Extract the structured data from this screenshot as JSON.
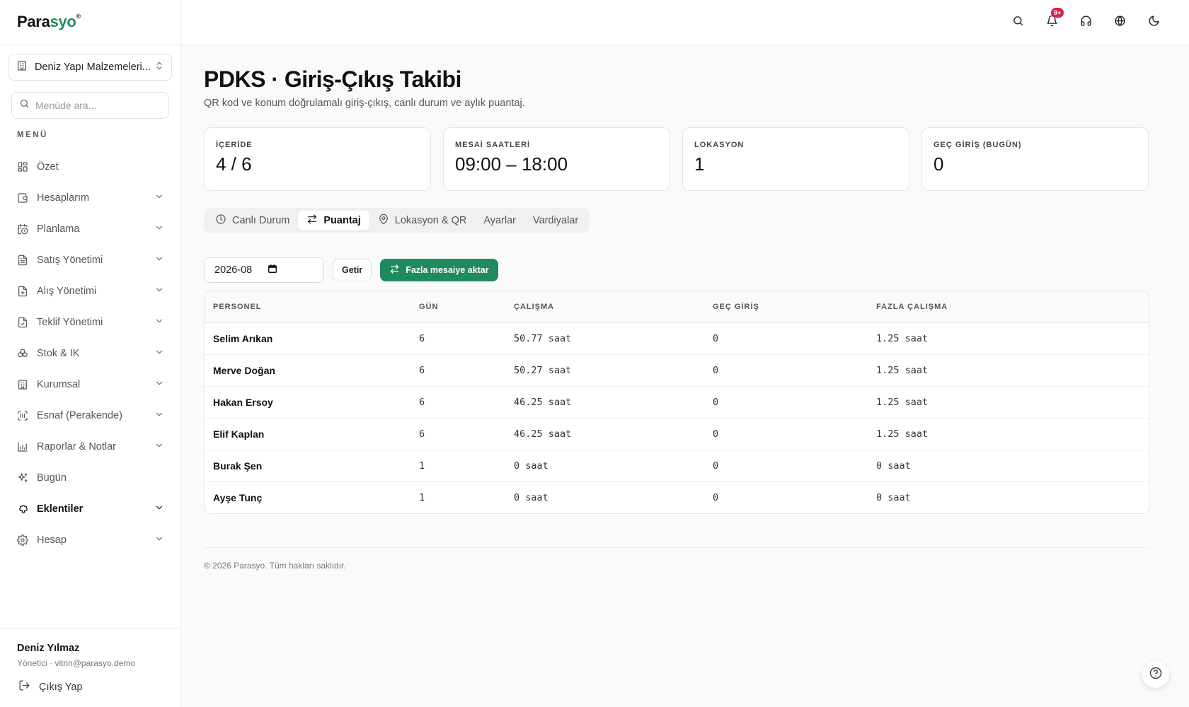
{
  "brand": {
    "part1": "Para",
    "part2": "syo",
    "mark": "®",
    "accent_color": "#1f8a5b"
  },
  "company": {
    "name": "Deniz Yapı Malzemeleri..."
  },
  "search": {
    "placeholder": "Menüde ara..."
  },
  "menu_label": "MENÜ",
  "nav": [
    {
      "label": "Özet",
      "icon": "grid-icon",
      "chevron": false
    },
    {
      "label": "Hesaplarım",
      "icon": "wallet-icon",
      "chevron": true
    },
    {
      "label": "Planlama",
      "icon": "calendar-clock-icon",
      "chevron": true
    },
    {
      "label": "Satış Yönetimi",
      "icon": "receipt-icon",
      "chevron": true
    },
    {
      "label": "Alış Yönetimi",
      "icon": "file-plus-icon",
      "chevron": true
    },
    {
      "label": "Teklif Yönetimi",
      "icon": "file-check-icon",
      "chevron": true
    },
    {
      "label": "Stok & IK",
      "icon": "boxes-icon",
      "chevron": true
    },
    {
      "label": "Kurumsal",
      "icon": "building-icon",
      "chevron": true
    },
    {
      "label": "Esnaf (Perakende)",
      "icon": "scan-icon",
      "chevron": true
    },
    {
      "label": "Raporlar & Notlar",
      "icon": "bar-chart-icon",
      "chevron": true
    },
    {
      "label": "Bugün",
      "icon": "sparkles-icon",
      "chevron": false
    },
    {
      "label": "Eklentiler",
      "icon": "puzzle-icon",
      "chevron": true,
      "active": true
    },
    {
      "label": "Hesap",
      "icon": "gear-icon",
      "chevron": true
    }
  ],
  "user": {
    "name": "Deniz Yılmaz",
    "subtitle": "Yönetici · vitrin@parasyo.demo",
    "logout_label": "Çıkış Yap"
  },
  "topbar": {
    "notification_badge": "9+"
  },
  "page": {
    "title": "PDKS · Giriş-Çıkış Takibi",
    "subtitle": "QR kod ve konum doğrulamalı giriş-çıkış, canlı durum ve aylık puantaj."
  },
  "stats": [
    {
      "label": "İÇERİDE",
      "value": "4 / 6"
    },
    {
      "label": "MESAİ SAATLERİ",
      "value": "09:00 – 18:00"
    },
    {
      "label": "LOKASYON",
      "value": "1"
    },
    {
      "label": "GEÇ GİRİŞ (BUGÜN)",
      "value": "0"
    }
  ],
  "tabs": [
    {
      "label": "Canlı Durum",
      "icon": "clock-icon"
    },
    {
      "label": "Puantaj",
      "icon": "arrows-swap-icon",
      "active": true
    },
    {
      "label": "Lokasyon & QR",
      "icon": "map-pin-icon"
    },
    {
      "label": "Ayarlar",
      "icon": ""
    },
    {
      "label": "Vardiyalar",
      "icon": ""
    }
  ],
  "controls": {
    "month_value": "2026-08",
    "fetch_label": "Getir",
    "transfer_label": "Fazla mesaiye aktar"
  },
  "table": {
    "headers": [
      "PERSONEL",
      "GÜN",
      "ÇALIŞMA",
      "GEÇ GİRİŞ",
      "FAZLA ÇALIŞMA"
    ],
    "rows": [
      [
        "Selim Arıkan",
        "6",
        "50.77 saat",
        "0",
        "1.25 saat"
      ],
      [
        "Merve Doğan",
        "6",
        "50.27 saat",
        "0",
        "1.25 saat"
      ],
      [
        "Hakan Ersoy",
        "6",
        "46.25 saat",
        "0",
        "1.25 saat"
      ],
      [
        "Elif Kaplan",
        "6",
        "46.25 saat",
        "0",
        "1.25 saat"
      ],
      [
        "Burak Şen",
        "1",
        "0 saat",
        "0",
        "0 saat"
      ],
      [
        "Ayşe Tunç",
        "1",
        "0 saat",
        "0",
        "0 saat"
      ]
    ]
  },
  "footer": "© 2026 Parasyo. Tüm hakları saklıdır."
}
